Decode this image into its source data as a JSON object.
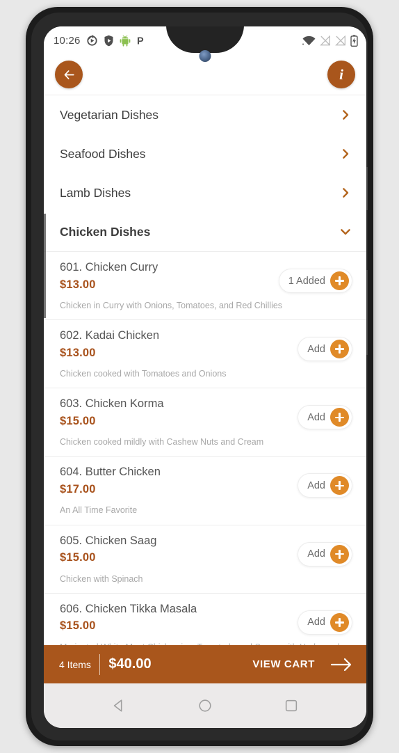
{
  "status_bar": {
    "time": "10:26",
    "left_icons": [
      "sync-icon",
      "shield-play-icon",
      "android-robot-icon",
      "p-icon"
    ],
    "right_icons": [
      "wifi-icon",
      "signal-off-icon",
      "signal-off-icon",
      "battery-charging-icon"
    ]
  },
  "app_bar": {
    "back_label": "←",
    "info_label": "i"
  },
  "categories": [
    {
      "label": "Vegetarian Dishes",
      "expanded": false
    },
    {
      "label": "Seafood Dishes",
      "expanded": false
    },
    {
      "label": "Lamb Dishes",
      "expanded": false
    },
    {
      "label": "Chicken Dishes",
      "expanded": true
    }
  ],
  "menu_items": [
    {
      "name": "601. Chicken Curry",
      "price": "$13.00",
      "description": "Chicken in Curry with Onions, Tomatoes, and Red Chillies",
      "add_label": "1 Added"
    },
    {
      "name": "602. Kadai Chicken",
      "price": "$13.00",
      "description": "Chicken cooked with Tomatoes and Onions",
      "add_label": "Add"
    },
    {
      "name": "603. Chicken Korma",
      "price": "$15.00",
      "description": "Chicken cooked mildly with Cashew Nuts and Cream",
      "add_label": "Add"
    },
    {
      "name": "604. Butter Chicken",
      "price": "$17.00",
      "description": "An All Time Favorite",
      "add_label": "Add"
    },
    {
      "name": "605. Chicken Saag",
      "price": "$15.00",
      "description": "Chicken with Spinach",
      "add_label": "Add"
    },
    {
      "name": "606. Chicken Tikka Masala",
      "price": "$15.00",
      "description": "Marinated White Meat Chicken in a Tomato-based Sauce with Herbs and Spices, a House Speciality",
      "add_label": "Add"
    }
  ],
  "cart_bar": {
    "item_count": "4 Items",
    "total": "$40.00",
    "view_cart_label": "VIEW CART"
  },
  "nav_bar": {
    "back": "nav-back-icon",
    "home": "nav-home-icon",
    "recents": "nav-recents-icon"
  },
  "colors": {
    "primary": "#a9561c",
    "accent": "#e08a28",
    "price": "#a8521c",
    "chevron": "#b4661f"
  }
}
